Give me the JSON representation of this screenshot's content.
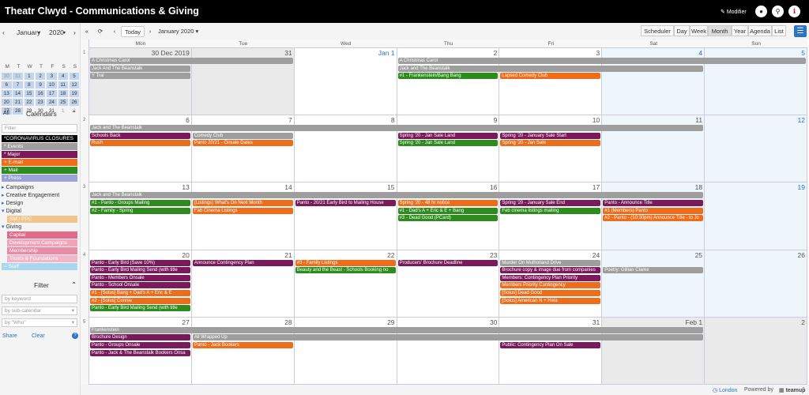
{
  "app": {
    "title": "Theatr Clwyd - Communications & Giving",
    "modifier": "Modifier"
  },
  "colors": {
    "grey": "#9e9e9e",
    "purple": "#7b1a5a",
    "green": "#2e8b1e",
    "orange": "#ef6c1a",
    "blue_link": "#2a73c6"
  },
  "mini_calendar": {
    "month": "January",
    "year": "2020",
    "dow": [
      "M",
      "T",
      "W",
      "T",
      "F",
      "S",
      "S"
    ],
    "weeks": [
      [
        "30",
        "31",
        "1",
        "2",
        "3",
        "4",
        "5"
      ],
      [
        "6",
        "7",
        "8",
        "9",
        "10",
        "11",
        "12"
      ],
      [
        "13",
        "14",
        "15",
        "16",
        "17",
        "18",
        "19"
      ],
      [
        "20",
        "21",
        "22",
        "23",
        "24",
        "25",
        "26"
      ],
      [
        "27",
        "28",
        "29",
        "30",
        "31",
        "1",
        "2"
      ]
    ]
  },
  "sidebar": {
    "all_label": "All",
    "calendars_label": "Calendars",
    "filter_placeholder": "Filter",
    "calendars": [
      {
        "label": "*CORONAVIRUS CLOSURES",
        "color": "#000000",
        "sub": false
      },
      {
        "label": "* Events",
        "color": "#9e9e9e",
        "sub": false
      },
      {
        "label": "* Major",
        "color": "#7b1a5a",
        "sub": false
      },
      {
        "label": "+ E-mail",
        "color": "#ef6c1a",
        "sub": false
      },
      {
        "label": "+ Mail",
        "color": "#2e8b1e",
        "sub": false
      },
      {
        "label": "+ Press",
        "color": "#9aa3d6",
        "sub": false
      }
    ],
    "folders": [
      {
        "label": "Campaigns",
        "open": false
      },
      {
        "label": "Creative Engagement",
        "open": false
      },
      {
        "label": "Design",
        "open": false
      },
      {
        "label": "Digital",
        "open": true,
        "children": [
          {
            "label": "SM / PPC",
            "color": "#f0c48a"
          }
        ]
      },
      {
        "label": "Giving",
        "open": true,
        "children": [
          {
            "label": "Capital",
            "color": "#e06a8a"
          },
          {
            "label": "Development Campaigns",
            "color": "#f0a4b8"
          },
          {
            "label": "Membership",
            "color": "#e98aa6"
          },
          {
            "label": "Trusts & Foundations",
            "color": "#f4b5c8"
          }
        ]
      }
    ],
    "staff": {
      "label": "~ Staff",
      "color": "#a9d7ee"
    },
    "filter_label": "Filter",
    "keyword_placeholder": "by keyword",
    "subcal_placeholder": "by sub-calendar",
    "who_placeholder": "by \"Who\"",
    "share": "Share",
    "clear": "Clear"
  },
  "toolbar": {
    "today": "Today",
    "month_label": "January 2020",
    "views": [
      {
        "label": "Scheduler",
        "active": false
      },
      {
        "label": "Day",
        "active": false
      },
      {
        "label": "Week",
        "active": false
      },
      {
        "label": "Month",
        "active": true
      },
      {
        "label": "Year",
        "active": false
      },
      {
        "label": "Agenda",
        "active": false
      },
      {
        "label": "List",
        "active": false
      }
    ]
  },
  "calendar": {
    "dow": [
      "Mon",
      "Tue",
      "Wed",
      "Thu",
      "Fri",
      "Sat",
      "Sun"
    ],
    "weeks": [
      {
        "num": "1",
        "days": [
          {
            "d": "30 Dec 2019",
            "cls": "other"
          },
          {
            "d": "31",
            "cls": "other"
          },
          {
            "d": "Jan 1",
            "cls": "",
            "blue": true
          },
          {
            "d": "2",
            "cls": ""
          },
          {
            "d": "3",
            "cls": ""
          },
          {
            "d": "4",
            "cls": "today",
            "blue": true
          },
          {
            "d": "5",
            "cls": "today",
            "blue": true
          }
        ],
        "events": [
          {
            "t": "A Christmas Carol",
            "c": 0,
            "span": 2,
            "row": 0,
            "color": "grey"
          },
          {
            "t": "Jack And The Beanstalk",
            "c": 0,
            "span": 1,
            "row": 1,
            "color": "grey"
          },
          {
            "t": "Y Tral",
            "c": 0,
            "span": 1,
            "row": 2,
            "color": "grey"
          },
          {
            "t": "A Christmas Carol",
            "c": 3,
            "span": 4,
            "row": 0,
            "color": "grey"
          },
          {
            "t": "Jack and The Beanstalk",
            "c": 3,
            "span": 3,
            "row": 1,
            "color": "grey"
          },
          {
            "t": "#1 - Frankenstein/Bang Bang",
            "c": 3,
            "span": 1,
            "row": 2,
            "color": "green"
          },
          {
            "t": "Lapsed Comedy Club",
            "c": 4,
            "span": 1,
            "row": 2,
            "color": "orange"
          }
        ]
      },
      {
        "num": "2",
        "days": [
          {
            "d": "6",
            "cls": ""
          },
          {
            "d": "7",
            "cls": ""
          },
          {
            "d": "8",
            "cls": ""
          },
          {
            "d": "9",
            "cls": ""
          },
          {
            "d": "10",
            "cls": ""
          },
          {
            "d": "11",
            "cls": "today"
          },
          {
            "d": "12",
            "cls": "today",
            "blue": true
          }
        ],
        "events": [
          {
            "t": "Jack and The Beanstalk",
            "c": 0,
            "span": 6,
            "row": 0,
            "color": "grey"
          },
          {
            "t": "Schools Back",
            "c": 0,
            "span": 1,
            "row": 1,
            "color": "purple"
          },
          {
            "t": "Rush",
            "c": 0,
            "span": 1,
            "row": 2,
            "color": "orange"
          },
          {
            "t": "Comedy Club",
            "c": 1,
            "span": 1,
            "row": 1,
            "color": "grey"
          },
          {
            "t": "Panto 20/21 - Onsale Dates",
            "c": 1,
            "span": 1,
            "row": 2,
            "color": "orange"
          },
          {
            "t": "Spring '20 - Jan Sale Land",
            "c": 3,
            "span": 1,
            "row": 1,
            "color": "purple"
          },
          {
            "t": "Spring '20 - Jan Sale Land",
            "c": 3,
            "span": 1,
            "row": 2,
            "color": "green"
          },
          {
            "t": "Spring '20 - January Sale Start",
            "c": 4,
            "span": 1,
            "row": 1,
            "color": "purple"
          },
          {
            "t": "Spring '20 - Jan Sale",
            "c": 4,
            "span": 1,
            "row": 2,
            "color": "orange"
          }
        ]
      },
      {
        "num": "3",
        "days": [
          {
            "d": "13",
            "cls": ""
          },
          {
            "d": "14",
            "cls": ""
          },
          {
            "d": "15",
            "cls": ""
          },
          {
            "d": "16",
            "cls": ""
          },
          {
            "d": "17",
            "cls": ""
          },
          {
            "d": "18",
            "cls": "today"
          },
          {
            "d": "19",
            "cls": "today",
            "blue": true
          }
        ],
        "events": [
          {
            "t": "Jack and The Beanstalk",
            "c": 0,
            "span": 6,
            "row": 0,
            "color": "grey"
          },
          {
            "t": "#1 - Panto - Groups Mailing",
            "c": 0,
            "span": 1,
            "row": 1,
            "color": "green"
          },
          {
            "t": "#2 - Family - Spring",
            "c": 0,
            "span": 1,
            "row": 2,
            "color": "green"
          },
          {
            "t": "(Listings) What's On Next Month",
            "c": 1,
            "span": 1,
            "row": 1,
            "color": "orange"
          },
          {
            "t": "Fab Cinema Listings",
            "c": 1,
            "span": 1,
            "row": 2,
            "color": "orange"
          },
          {
            "t": "Panto - 20/21 Early Bird to Mailing House",
            "c": 2,
            "span": 1,
            "row": 1,
            "color": "purple"
          },
          {
            "t": "Spring '20 - 48 hr notice",
            "c": 3,
            "span": 1,
            "row": 1,
            "color": "orange"
          },
          {
            "t": "#1 - Dad's A + Eric & E + Bang",
            "c": 3,
            "span": 1,
            "row": 2,
            "color": "green"
          },
          {
            "t": "#3 - Dead Good (PCard)",
            "c": 3,
            "span": 1,
            "row": 3,
            "color": "green"
          },
          {
            "t": "Spring '20 - January Sale End",
            "c": 4,
            "span": 1,
            "row": 1,
            "color": "purple"
          },
          {
            "t": "Feb cinema listings mailing",
            "c": 4,
            "span": 1,
            "row": 2,
            "color": "green"
          },
          {
            "t": "Panto - Announce Title",
            "c": 5,
            "span": 1,
            "row": 1,
            "color": "purple"
          },
          {
            "t": "#1 (Members) Panto",
            "c": 5,
            "span": 1,
            "row": 2,
            "color": "orange"
          },
          {
            "t": "#2 - Panto - (10:30pm) Announce Title - to Jo",
            "c": 5,
            "span": 1,
            "row": 3,
            "color": "orange"
          }
        ]
      },
      {
        "num": "4",
        "days": [
          {
            "d": "20",
            "cls": ""
          },
          {
            "d": "21",
            "cls": ""
          },
          {
            "d": "22",
            "cls": ""
          },
          {
            "d": "23",
            "cls": ""
          },
          {
            "d": "24",
            "cls": ""
          },
          {
            "d": "25",
            "cls": "today"
          },
          {
            "d": "26",
            "cls": "today"
          }
        ],
        "events": [
          {
            "t": "Panto - Early Bird (Save 10%)",
            "c": 0,
            "span": 1,
            "row": 0,
            "color": "purple"
          },
          {
            "t": "Panto - Early Bird Mailing Send (with title",
            "c": 0,
            "span": 1,
            "row": 1,
            "color": "purple"
          },
          {
            "t": "Panto - Members Onsale",
            "c": 0,
            "span": 1,
            "row": 2,
            "color": "purple"
          },
          {
            "t": "Panto - School Onsale",
            "c": 0,
            "span": 1,
            "row": 3,
            "color": "purple"
          },
          {
            "t": "#1 - [Solus] Bang + Dad's A + Eric & E",
            "c": 0,
            "span": 1,
            "row": 4,
            "color": "orange"
          },
          {
            "t": "#2 - [Solus] Connie",
            "c": 0,
            "span": 1,
            "row": 5,
            "color": "orange"
          },
          {
            "t": "Panto - Early Bird Mailing Send (with title",
            "c": 0,
            "span": 1,
            "row": 6,
            "color": "green"
          },
          {
            "t": "Announce Contingency Plan",
            "c": 1,
            "span": 1,
            "row": 0,
            "color": "purple"
          },
          {
            "t": "#3 - Family Listings",
            "c": 2,
            "span": 1,
            "row": 0,
            "color": "orange"
          },
          {
            "t": "Beauty and the Beast - Schools Booking no",
            "c": 2,
            "span": 1,
            "row": 1,
            "color": "green"
          },
          {
            "t": "Producers' Brochure Deadline",
            "c": 3,
            "span": 1,
            "row": 0,
            "color": "purple"
          },
          {
            "t": "Murder On Mulholland Drive",
            "c": 4,
            "span": 1,
            "row": 0,
            "color": "grey"
          },
          {
            "t": "Brochure copy & image due from companies",
            "c": 4,
            "span": 1,
            "row": 1,
            "color": "purple"
          },
          {
            "t": "Members: Contingency Plan Priority",
            "c": 4,
            "span": 1,
            "row": 2,
            "color": "purple"
          },
          {
            "t": "Members Priority Contingency",
            "c": 4,
            "span": 1,
            "row": 3,
            "color": "orange"
          },
          {
            "t": "[Solus] Dead Good",
            "c": 4,
            "span": 1,
            "row": 4,
            "color": "orange"
          },
          {
            "t": "[Solus] American N + Hela",
            "c": 4,
            "span": 1,
            "row": 5,
            "color": "orange"
          },
          {
            "t": "Poetry: Gillian Clarke",
            "c": 5,
            "span": 1,
            "row": 1,
            "color": "grey"
          }
        ]
      },
      {
        "num": "5",
        "days": [
          {
            "d": "27",
            "cls": ""
          },
          {
            "d": "28",
            "cls": ""
          },
          {
            "d": "29",
            "cls": ""
          },
          {
            "d": "30",
            "cls": ""
          },
          {
            "d": "31",
            "cls": ""
          },
          {
            "d": "Feb 1",
            "cls": "other"
          },
          {
            "d": "2",
            "cls": "other"
          }
        ],
        "events": [
          {
            "t": "Frankenstein",
            "c": 0,
            "span": 6,
            "row": 0,
            "color": "grey"
          },
          {
            "t": "Brochure Design",
            "c": 0,
            "span": 1,
            "row": 1,
            "color": "purple"
          },
          {
            "t": "Panto - Groups Onsale",
            "c": 0,
            "span": 1,
            "row": 2,
            "color": "purple"
          },
          {
            "t": "Panto - Jack & The Beanstalk Bookers Onsa",
            "c": 0,
            "span": 1,
            "row": 3,
            "color": "purple"
          },
          {
            "t": "All Wrapped Up",
            "c": 1,
            "span": 5,
            "row": 1,
            "color": "grey"
          },
          {
            "t": "Panto - Jack Bookers",
            "c": 1,
            "span": 1,
            "row": 2,
            "color": "orange"
          },
          {
            "t": "Public: Contingency Plan On Sale",
            "c": 4,
            "span": 1,
            "row": 2,
            "color": "purple"
          }
        ]
      }
    ]
  },
  "footer": {
    "timezone": "London",
    "powered_by": "Powered by",
    "brand": "teamup"
  }
}
